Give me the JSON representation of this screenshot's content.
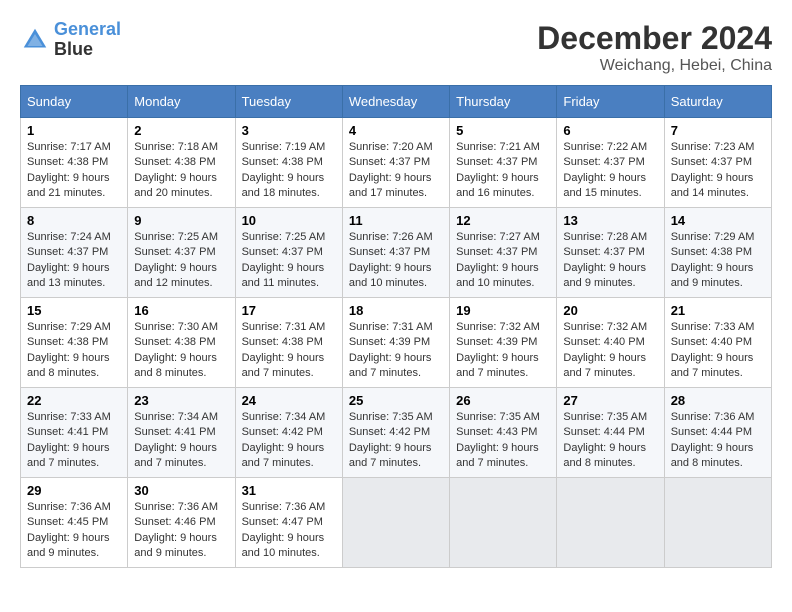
{
  "header": {
    "logo_line1": "General",
    "logo_line2": "Blue",
    "month": "December 2024",
    "location": "Weichang, Hebei, China"
  },
  "weekdays": [
    "Sunday",
    "Monday",
    "Tuesday",
    "Wednesday",
    "Thursday",
    "Friday",
    "Saturday"
  ],
  "weeks": [
    [
      {
        "day": "1",
        "sunrise": "Sunrise: 7:17 AM",
        "sunset": "Sunset: 4:38 PM",
        "daylight": "Daylight: 9 hours and 21 minutes."
      },
      {
        "day": "2",
        "sunrise": "Sunrise: 7:18 AM",
        "sunset": "Sunset: 4:38 PM",
        "daylight": "Daylight: 9 hours and 20 minutes."
      },
      {
        "day": "3",
        "sunrise": "Sunrise: 7:19 AM",
        "sunset": "Sunset: 4:38 PM",
        "daylight": "Daylight: 9 hours and 18 minutes."
      },
      {
        "day": "4",
        "sunrise": "Sunrise: 7:20 AM",
        "sunset": "Sunset: 4:37 PM",
        "daylight": "Daylight: 9 hours and 17 minutes."
      },
      {
        "day": "5",
        "sunrise": "Sunrise: 7:21 AM",
        "sunset": "Sunset: 4:37 PM",
        "daylight": "Daylight: 9 hours and 16 minutes."
      },
      {
        "day": "6",
        "sunrise": "Sunrise: 7:22 AM",
        "sunset": "Sunset: 4:37 PM",
        "daylight": "Daylight: 9 hours and 15 minutes."
      },
      {
        "day": "7",
        "sunrise": "Sunrise: 7:23 AM",
        "sunset": "Sunset: 4:37 PM",
        "daylight": "Daylight: 9 hours and 14 minutes."
      }
    ],
    [
      {
        "day": "8",
        "sunrise": "Sunrise: 7:24 AM",
        "sunset": "Sunset: 4:37 PM",
        "daylight": "Daylight: 9 hours and 13 minutes."
      },
      {
        "day": "9",
        "sunrise": "Sunrise: 7:25 AM",
        "sunset": "Sunset: 4:37 PM",
        "daylight": "Daylight: 9 hours and 12 minutes."
      },
      {
        "day": "10",
        "sunrise": "Sunrise: 7:25 AM",
        "sunset": "Sunset: 4:37 PM",
        "daylight": "Daylight: 9 hours and 11 minutes."
      },
      {
        "day": "11",
        "sunrise": "Sunrise: 7:26 AM",
        "sunset": "Sunset: 4:37 PM",
        "daylight": "Daylight: 9 hours and 10 minutes."
      },
      {
        "day": "12",
        "sunrise": "Sunrise: 7:27 AM",
        "sunset": "Sunset: 4:37 PM",
        "daylight": "Daylight: 9 hours and 10 minutes."
      },
      {
        "day": "13",
        "sunrise": "Sunrise: 7:28 AM",
        "sunset": "Sunset: 4:37 PM",
        "daylight": "Daylight: 9 hours and 9 minutes."
      },
      {
        "day": "14",
        "sunrise": "Sunrise: 7:29 AM",
        "sunset": "Sunset: 4:38 PM",
        "daylight": "Daylight: 9 hours and 9 minutes."
      }
    ],
    [
      {
        "day": "15",
        "sunrise": "Sunrise: 7:29 AM",
        "sunset": "Sunset: 4:38 PM",
        "daylight": "Daylight: 9 hours and 8 minutes."
      },
      {
        "day": "16",
        "sunrise": "Sunrise: 7:30 AM",
        "sunset": "Sunset: 4:38 PM",
        "daylight": "Daylight: 9 hours and 8 minutes."
      },
      {
        "day": "17",
        "sunrise": "Sunrise: 7:31 AM",
        "sunset": "Sunset: 4:38 PM",
        "daylight": "Daylight: 9 hours and 7 minutes."
      },
      {
        "day": "18",
        "sunrise": "Sunrise: 7:31 AM",
        "sunset": "Sunset: 4:39 PM",
        "daylight": "Daylight: 9 hours and 7 minutes."
      },
      {
        "day": "19",
        "sunrise": "Sunrise: 7:32 AM",
        "sunset": "Sunset: 4:39 PM",
        "daylight": "Daylight: 9 hours and 7 minutes."
      },
      {
        "day": "20",
        "sunrise": "Sunrise: 7:32 AM",
        "sunset": "Sunset: 4:40 PM",
        "daylight": "Daylight: 9 hours and 7 minutes."
      },
      {
        "day": "21",
        "sunrise": "Sunrise: 7:33 AM",
        "sunset": "Sunset: 4:40 PM",
        "daylight": "Daylight: 9 hours and 7 minutes."
      }
    ],
    [
      {
        "day": "22",
        "sunrise": "Sunrise: 7:33 AM",
        "sunset": "Sunset: 4:41 PM",
        "daylight": "Daylight: 9 hours and 7 minutes."
      },
      {
        "day": "23",
        "sunrise": "Sunrise: 7:34 AM",
        "sunset": "Sunset: 4:41 PM",
        "daylight": "Daylight: 9 hours and 7 minutes."
      },
      {
        "day": "24",
        "sunrise": "Sunrise: 7:34 AM",
        "sunset": "Sunset: 4:42 PM",
        "daylight": "Daylight: 9 hours and 7 minutes."
      },
      {
        "day": "25",
        "sunrise": "Sunrise: 7:35 AM",
        "sunset": "Sunset: 4:42 PM",
        "daylight": "Daylight: 9 hours and 7 minutes."
      },
      {
        "day": "26",
        "sunrise": "Sunrise: 7:35 AM",
        "sunset": "Sunset: 4:43 PM",
        "daylight": "Daylight: 9 hours and 7 minutes."
      },
      {
        "day": "27",
        "sunrise": "Sunrise: 7:35 AM",
        "sunset": "Sunset: 4:44 PM",
        "daylight": "Daylight: 9 hours and 8 minutes."
      },
      {
        "day": "28",
        "sunrise": "Sunrise: 7:36 AM",
        "sunset": "Sunset: 4:44 PM",
        "daylight": "Daylight: 9 hours and 8 minutes."
      }
    ],
    [
      {
        "day": "29",
        "sunrise": "Sunrise: 7:36 AM",
        "sunset": "Sunset: 4:45 PM",
        "daylight": "Daylight: 9 hours and 9 minutes."
      },
      {
        "day": "30",
        "sunrise": "Sunrise: 7:36 AM",
        "sunset": "Sunset: 4:46 PM",
        "daylight": "Daylight: 9 hours and 9 minutes."
      },
      {
        "day": "31",
        "sunrise": "Sunrise: 7:36 AM",
        "sunset": "Sunset: 4:47 PM",
        "daylight": "Daylight: 9 hours and 10 minutes."
      },
      null,
      null,
      null,
      null
    ]
  ]
}
